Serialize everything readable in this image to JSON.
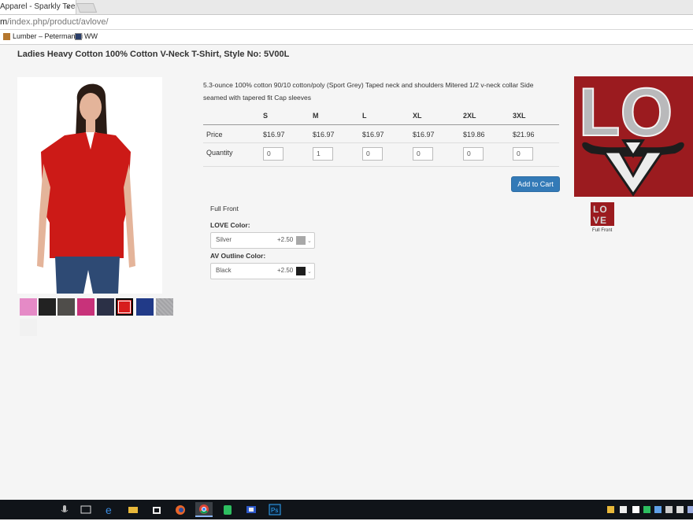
{
  "browser": {
    "tab_title": "Apparel - Sparkly Tees –",
    "tab_close": "×",
    "url_host": "m",
    "url_path": "/index.php/product/avlove/",
    "bookmarks": [
      {
        "label": "Lumber – Peterman Li",
        "icon": "lumber-favicon"
      },
      {
        "label": "WW",
        "icon": "ww-favicon"
      }
    ]
  },
  "product": {
    "title": "Ladies Heavy Cotton 100% Cotton V-Neck T-Shirt, Style No: 5V00L",
    "description": "5.3-ounce 100% cotton 90/10 cotton/poly (Sport Grey) Taped neck and shoulders Mitered 1/2 v-neck collar Side seamed with tapered fit Cap sleeves",
    "shirt_color": "#cc1a17",
    "swatches": [
      {
        "color": "#e58ac6",
        "selected": false
      },
      {
        "color": "#222222",
        "selected": false
      },
      {
        "color": "#4f4d4a",
        "selected": false
      },
      {
        "color": "#c8327a",
        "selected": false
      },
      {
        "color": "#2b3046",
        "selected": false
      },
      {
        "color": "#d71d1d",
        "selected": true
      },
      {
        "color": "#213a88",
        "selected": false
      },
      {
        "color": "#a3a3a6",
        "selected": false
      },
      {
        "color": "#f1f1f1",
        "selected": false
      }
    ]
  },
  "size_table": {
    "price_label": "Price",
    "quantity_label": "Quantity",
    "sizes": [
      {
        "size": "S",
        "price": "$16.97",
        "qty": "0"
      },
      {
        "size": "M",
        "price": "$16.97",
        "qty": "1"
      },
      {
        "size": "L",
        "price": "$16.97",
        "qty": "0"
      },
      {
        "size": "XL",
        "price": "$16.97",
        "qty": "0"
      },
      {
        "size": "2XL",
        "price": "$19.86",
        "qty": "0"
      },
      {
        "size": "3XL",
        "price": "$21.96",
        "qty": "0"
      }
    ]
  },
  "add_to_cart": "Add to Cart",
  "options": {
    "location": "Full Front",
    "love_color_label": "LOVE Color:",
    "love_color": {
      "name": "Silver",
      "price": "+2.50",
      "chip": "#a8a8a8"
    },
    "outline_label": "AV Outline Color:",
    "outline_color": {
      "name": "Black",
      "price": "+2.50",
      "chip": "#1e1e1e"
    }
  },
  "design": {
    "letters_top": "LO",
    "letters_bottom": "VE",
    "thumb_caption": "Full Front",
    "background": "#9b1b1f",
    "letter_color": "#b9b9bb"
  },
  "taskbar": {
    "icons": [
      "microphone-icon",
      "task-view-icon",
      "edge-icon",
      "file-explorer-icon",
      "store-icon",
      "firefox-icon",
      "chrome-icon",
      "evernote-icon",
      "app-icon",
      "photoshop-icon"
    ],
    "photoshop_label": "Ps"
  }
}
